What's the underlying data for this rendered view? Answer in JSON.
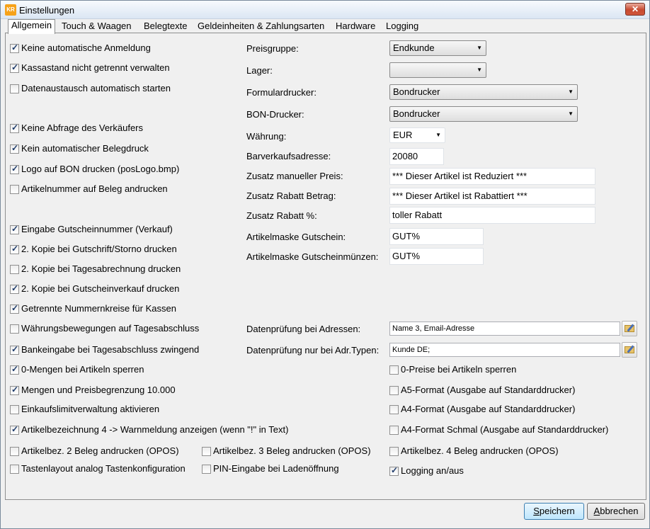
{
  "window": {
    "title": "Einstellungen",
    "close_label": "✕",
    "app_icon_label": "KR"
  },
  "tabs": [
    "Allgemein",
    "Touch & Waagen",
    "Belegtexte",
    "Geldeinheiten & Zahlungsarten",
    "Hardware",
    "Logging"
  ],
  "checks_left": [
    {
      "label": "Keine automatische Anmeldung",
      "checked": true
    },
    {
      "label": "Kassastand nicht getrennt verwalten",
      "checked": true
    },
    {
      "label": "Datenaustausch automatisch starten",
      "checked": false
    },
    {
      "label": "Keine Abfrage des Verkäufers",
      "checked": true
    },
    {
      "label": "Kein automatischer Belegdruck",
      "checked": true
    },
    {
      "label": "Logo auf BON drucken (posLogo.bmp)",
      "checked": true
    },
    {
      "label": "Artikelnummer auf Beleg andrucken",
      "checked": false
    },
    {
      "label": "Eingabe Gutscheinnummer (Verkauf)",
      "checked": true
    },
    {
      "label": "2. Kopie bei Gutschrift/Storno drucken",
      "checked": true
    },
    {
      "label": "2. Kopie bei Tagesabrechnung drucken",
      "checked": false
    },
    {
      "label": "2. Kopie bei Gutscheinverkauf drucken",
      "checked": true
    },
    {
      "label": "Getrennte Nummernkreise für Kassen",
      "checked": true
    },
    {
      "label": "Währungsbewegungen auf Tagesabschluss",
      "checked": false
    },
    {
      "label": "Bankeingabe bei Tagesabschluss zwingend",
      "checked": true
    },
    {
      "label": "0-Mengen bei Artikeln sperren",
      "checked": true
    },
    {
      "label": "Mengen und Preisbegrenzung 10.000",
      "checked": true
    },
    {
      "label": "Einkaufslimitverwaltung aktivieren",
      "checked": false
    },
    {
      "label": "Artikelbezeichnung 4 -> Warnmeldung anzeigen (wenn \"!\" in Text)",
      "checked": true
    },
    {
      "label": "Artikelbez. 2 Beleg andrucken (OPOS)",
      "checked": false
    },
    {
      "label": "Tastenlayout analog Tastenkonfiguration",
      "checked": false
    }
  ],
  "checks_mid": [
    {
      "label": "Artikelbez. 3 Beleg andrucken (OPOS)",
      "checked": false
    },
    {
      "label": "PIN-Eingabe bei Ladenöffnung",
      "checked": false
    }
  ],
  "checks_right": [
    {
      "label": "0-Preise bei Artikeln sperren",
      "checked": false
    },
    {
      "label": "A5-Format (Ausgabe auf Standarddrucker)",
      "checked": false
    },
    {
      "label": "A4-Format (Ausgabe auf Standarddrucker)",
      "checked": false
    },
    {
      "label": "A4-Format Schmal (Ausgabe auf Standarddrucker)",
      "checked": false
    },
    {
      "label": "Artikelbez. 4 Beleg andrucken (OPOS)",
      "checked": false
    },
    {
      "label": "Logging an/aus",
      "checked": true
    }
  ],
  "form": {
    "preisgruppe_label": "Preisgruppe:",
    "preisgruppe_value": "Endkunde",
    "lager_label": "Lager:",
    "lager_value": "",
    "formulardrucker_label": "Formulardrucker:",
    "formulardrucker_value": "Bondrucker",
    "bondrucker_label": "BON-Drucker:",
    "bondrucker_value": "Bondrucker",
    "waehrung_label": "Währung:",
    "waehrung_value": "EUR",
    "barverkauf_label": "Barverkaufsadresse:",
    "barverkauf_value": "20080",
    "zusatz_preis_label": "Zusatz manueller Preis:",
    "zusatz_preis_value": "*** Dieser Artikel ist Reduziert ***",
    "zusatz_rabatt_betrag_label": "Zusatz Rabatt Betrag:",
    "zusatz_rabatt_betrag_value": "*** Dieser Artikel ist Rabattiert ***",
    "zusatz_rabatt_pct_label": "Zusatz Rabatt %:",
    "zusatz_rabatt_pct_value": "toller Rabatt",
    "maske_gutschein_label": "Artikelmaske Gutschein:",
    "maske_gutschein_value": "GUT%",
    "maske_muenzen_label": "Artikelmaske Gutscheinmünzen:",
    "maske_muenzen_value": "GUT%",
    "pruefung_adressen_label": "Datenprüfung bei Adressen:",
    "pruefung_adressen_value": "Name 3, Email-Adresse",
    "pruefung_typen_label": "Datenprüfung nur bei Adr.Typen:",
    "pruefung_typen_value": "Kunde DE;"
  },
  "buttons": {
    "save_first": "S",
    "save_rest": "peichern",
    "cancel_first": "A",
    "cancel_rest": "bbrechen"
  }
}
